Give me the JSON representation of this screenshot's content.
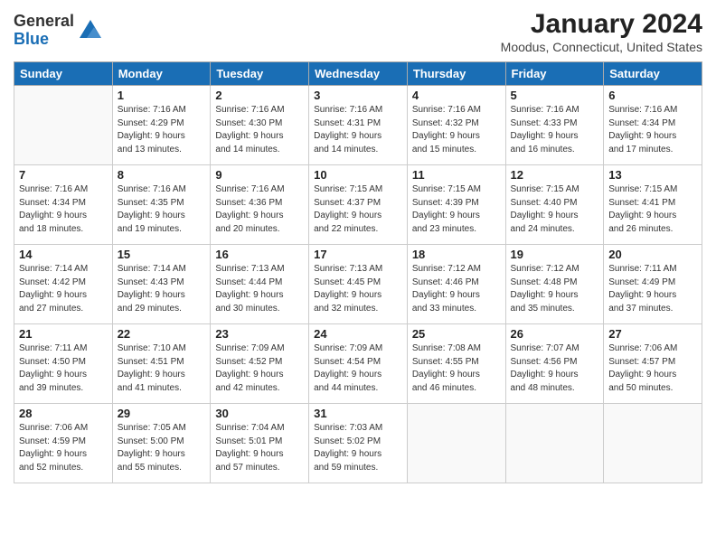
{
  "header": {
    "logo_line1": "General",
    "logo_line2": "Blue",
    "month": "January 2024",
    "location": "Moodus, Connecticut, United States"
  },
  "days_of_week": [
    "Sunday",
    "Monday",
    "Tuesday",
    "Wednesday",
    "Thursday",
    "Friday",
    "Saturday"
  ],
  "weeks": [
    [
      {
        "day": "",
        "info": ""
      },
      {
        "day": "1",
        "info": "Sunrise: 7:16 AM\nSunset: 4:29 PM\nDaylight: 9 hours\nand 13 minutes."
      },
      {
        "day": "2",
        "info": "Sunrise: 7:16 AM\nSunset: 4:30 PM\nDaylight: 9 hours\nand 14 minutes."
      },
      {
        "day": "3",
        "info": "Sunrise: 7:16 AM\nSunset: 4:31 PM\nDaylight: 9 hours\nand 14 minutes."
      },
      {
        "day": "4",
        "info": "Sunrise: 7:16 AM\nSunset: 4:32 PM\nDaylight: 9 hours\nand 15 minutes."
      },
      {
        "day": "5",
        "info": "Sunrise: 7:16 AM\nSunset: 4:33 PM\nDaylight: 9 hours\nand 16 minutes."
      },
      {
        "day": "6",
        "info": "Sunrise: 7:16 AM\nSunset: 4:34 PM\nDaylight: 9 hours\nand 17 minutes."
      }
    ],
    [
      {
        "day": "7",
        "info": "Sunrise: 7:16 AM\nSunset: 4:34 PM\nDaylight: 9 hours\nand 18 minutes."
      },
      {
        "day": "8",
        "info": "Sunrise: 7:16 AM\nSunset: 4:35 PM\nDaylight: 9 hours\nand 19 minutes."
      },
      {
        "day": "9",
        "info": "Sunrise: 7:16 AM\nSunset: 4:36 PM\nDaylight: 9 hours\nand 20 minutes."
      },
      {
        "day": "10",
        "info": "Sunrise: 7:15 AM\nSunset: 4:37 PM\nDaylight: 9 hours\nand 22 minutes."
      },
      {
        "day": "11",
        "info": "Sunrise: 7:15 AM\nSunset: 4:39 PM\nDaylight: 9 hours\nand 23 minutes."
      },
      {
        "day": "12",
        "info": "Sunrise: 7:15 AM\nSunset: 4:40 PM\nDaylight: 9 hours\nand 24 minutes."
      },
      {
        "day": "13",
        "info": "Sunrise: 7:15 AM\nSunset: 4:41 PM\nDaylight: 9 hours\nand 26 minutes."
      }
    ],
    [
      {
        "day": "14",
        "info": "Sunrise: 7:14 AM\nSunset: 4:42 PM\nDaylight: 9 hours\nand 27 minutes."
      },
      {
        "day": "15",
        "info": "Sunrise: 7:14 AM\nSunset: 4:43 PM\nDaylight: 9 hours\nand 29 minutes."
      },
      {
        "day": "16",
        "info": "Sunrise: 7:13 AM\nSunset: 4:44 PM\nDaylight: 9 hours\nand 30 minutes."
      },
      {
        "day": "17",
        "info": "Sunrise: 7:13 AM\nSunset: 4:45 PM\nDaylight: 9 hours\nand 32 minutes."
      },
      {
        "day": "18",
        "info": "Sunrise: 7:12 AM\nSunset: 4:46 PM\nDaylight: 9 hours\nand 33 minutes."
      },
      {
        "day": "19",
        "info": "Sunrise: 7:12 AM\nSunset: 4:48 PM\nDaylight: 9 hours\nand 35 minutes."
      },
      {
        "day": "20",
        "info": "Sunrise: 7:11 AM\nSunset: 4:49 PM\nDaylight: 9 hours\nand 37 minutes."
      }
    ],
    [
      {
        "day": "21",
        "info": "Sunrise: 7:11 AM\nSunset: 4:50 PM\nDaylight: 9 hours\nand 39 minutes."
      },
      {
        "day": "22",
        "info": "Sunrise: 7:10 AM\nSunset: 4:51 PM\nDaylight: 9 hours\nand 41 minutes."
      },
      {
        "day": "23",
        "info": "Sunrise: 7:09 AM\nSunset: 4:52 PM\nDaylight: 9 hours\nand 42 minutes."
      },
      {
        "day": "24",
        "info": "Sunrise: 7:09 AM\nSunset: 4:54 PM\nDaylight: 9 hours\nand 44 minutes."
      },
      {
        "day": "25",
        "info": "Sunrise: 7:08 AM\nSunset: 4:55 PM\nDaylight: 9 hours\nand 46 minutes."
      },
      {
        "day": "26",
        "info": "Sunrise: 7:07 AM\nSunset: 4:56 PM\nDaylight: 9 hours\nand 48 minutes."
      },
      {
        "day": "27",
        "info": "Sunrise: 7:06 AM\nSunset: 4:57 PM\nDaylight: 9 hours\nand 50 minutes."
      }
    ],
    [
      {
        "day": "28",
        "info": "Sunrise: 7:06 AM\nSunset: 4:59 PM\nDaylight: 9 hours\nand 52 minutes."
      },
      {
        "day": "29",
        "info": "Sunrise: 7:05 AM\nSunset: 5:00 PM\nDaylight: 9 hours\nand 55 minutes."
      },
      {
        "day": "30",
        "info": "Sunrise: 7:04 AM\nSunset: 5:01 PM\nDaylight: 9 hours\nand 57 minutes."
      },
      {
        "day": "31",
        "info": "Sunrise: 7:03 AM\nSunset: 5:02 PM\nDaylight: 9 hours\nand 59 minutes."
      },
      {
        "day": "",
        "info": ""
      },
      {
        "day": "",
        "info": ""
      },
      {
        "day": "",
        "info": ""
      }
    ]
  ]
}
